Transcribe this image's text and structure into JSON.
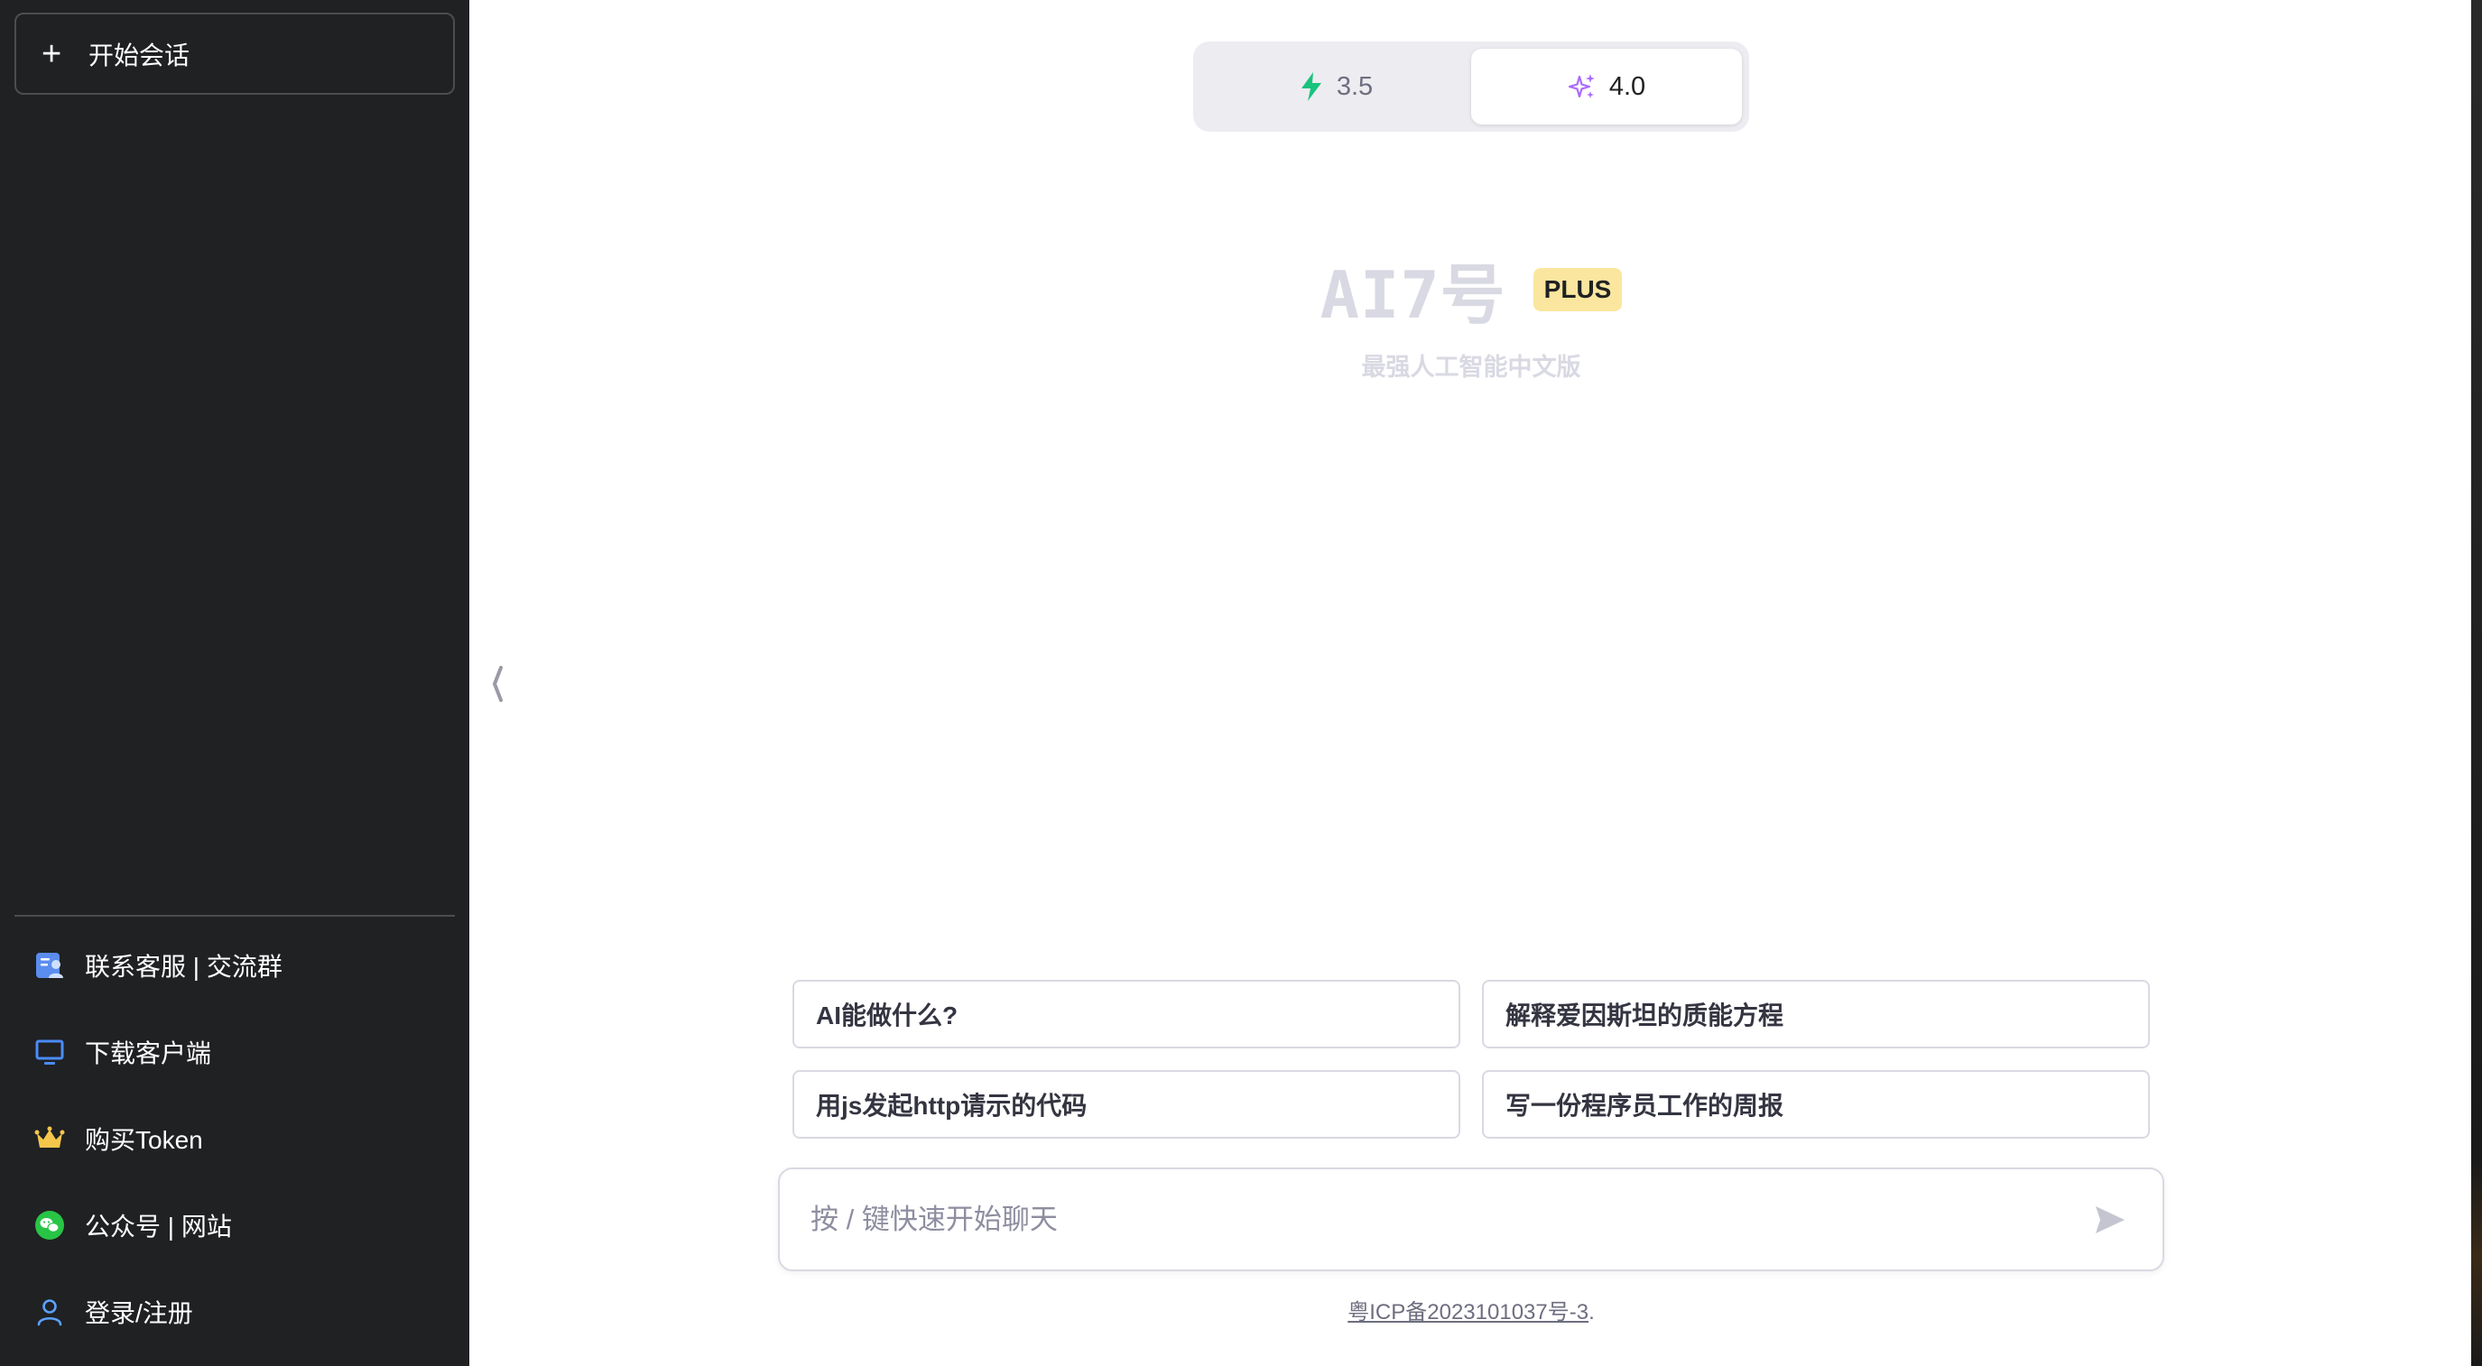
{
  "sidebar": {
    "new_chat_label": "开始会话",
    "items": [
      {
        "label": "联系客服 | 交流群",
        "icon": "support-contact-icon"
      },
      {
        "label": "下载客户端",
        "icon": "monitor-icon"
      },
      {
        "label": "购买Token",
        "icon": "crown-icon"
      },
      {
        "label": "公众号 | 网站",
        "icon": "wechat-icon"
      },
      {
        "label": "登录/注册",
        "icon": "user-icon"
      }
    ]
  },
  "model_toggle": {
    "options": [
      {
        "label": "3.5",
        "icon": "lightning-icon",
        "icon_color": "#19c37d"
      },
      {
        "label": "4.0",
        "icon": "sparkles-icon",
        "icon_color": "#ab68ff"
      }
    ],
    "selected": "4.0"
  },
  "hero": {
    "title": "AI7号",
    "badge": "PLUS",
    "subtitle": "最强人工智能中文版"
  },
  "suggestions": [
    "AI能做什么?",
    "解释爱因斯坦的质能方程",
    "用js发起http请示的代码",
    "写一份程序员工作的周报"
  ],
  "input": {
    "placeholder": "按 / 键快速开始聊天",
    "value": ""
  },
  "footer": {
    "icp_link": "粤ICP备2023101037号-3",
    "suffix": "."
  },
  "colors": {
    "sidebar_bg": "#202123",
    "badge_bg": "#fae69e",
    "lightning": "#19c37d",
    "sparkles": "#ab68ff"
  }
}
